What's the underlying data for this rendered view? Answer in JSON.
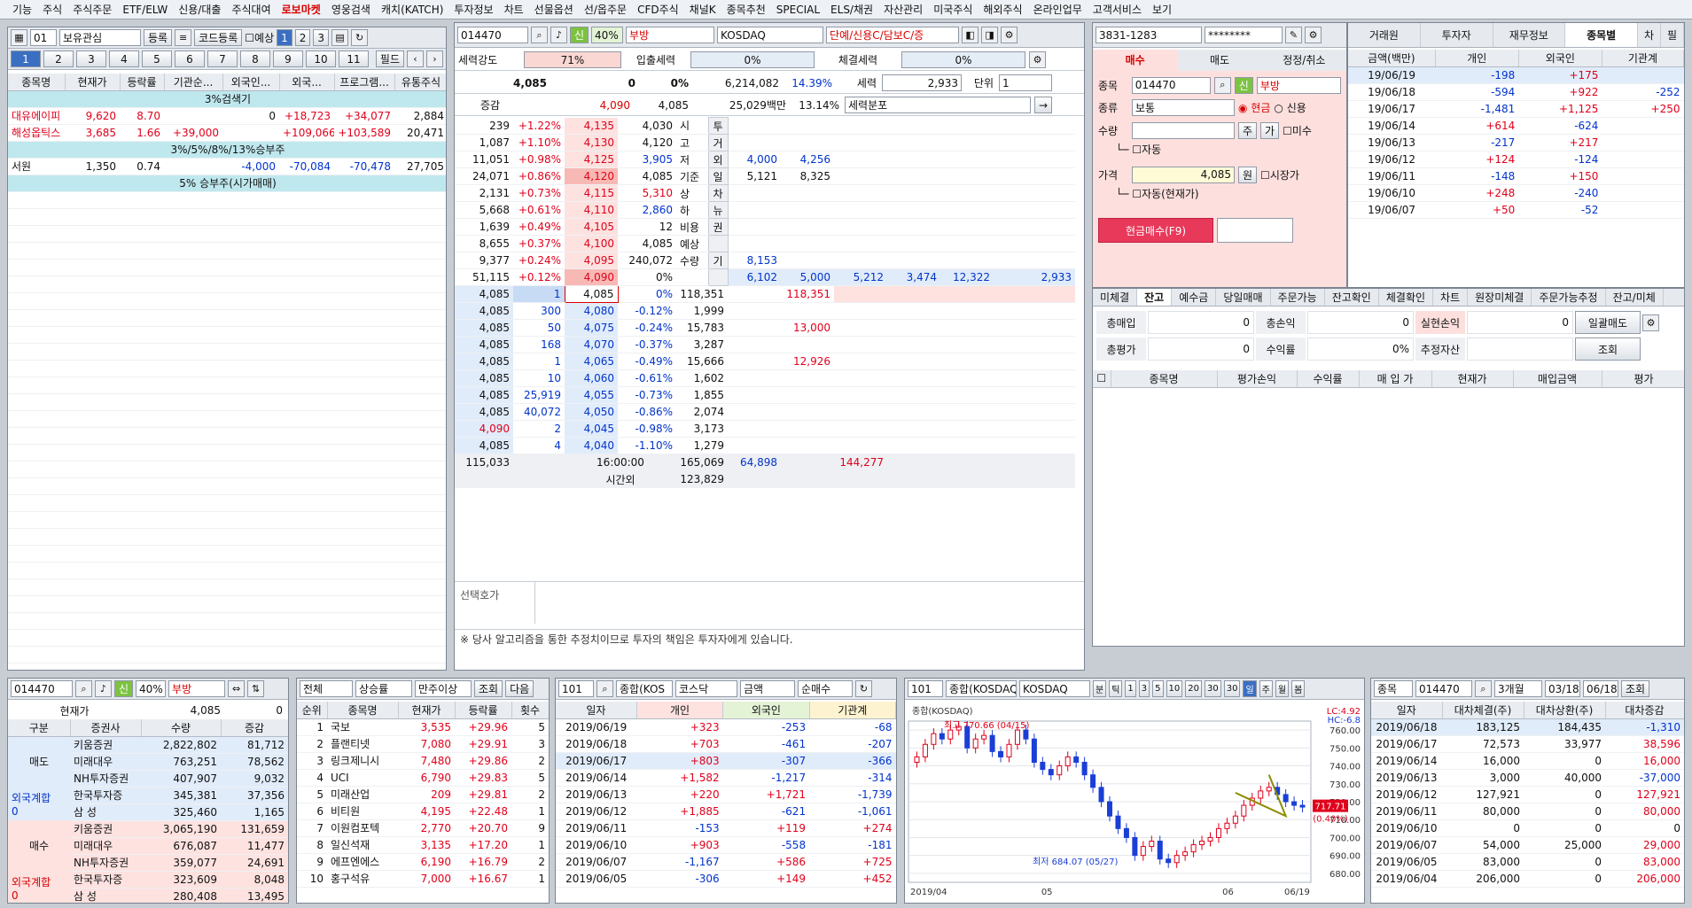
{
  "menu": [
    "기능",
    "주식",
    "주식주문",
    "ETF/ELW",
    "신용/대출",
    "주식대여",
    "로보마켓",
    "영웅검색",
    "캐치(KATCH)",
    "투자정보",
    "차트",
    "선물옵션",
    "선/옵주문",
    "CFD주식",
    "채널K",
    "종목추천",
    "SPECIAL",
    "ELS/채권",
    "자산관리",
    "미국주식",
    "해외주식",
    "온라인업무",
    "고객서비스",
    "보기"
  ],
  "menu_highlight": "로보마켓",
  "watch": {
    "group_no": "01",
    "group_name": "보유관심",
    "register": "등록",
    "code_register": "코드등록",
    "forecast": "예상",
    "pages": [
      "1",
      "2",
      "3"
    ],
    "tabs": [
      "1",
      "2",
      "3",
      "4",
      "5",
      "6",
      "7",
      "8",
      "9",
      "10",
      "11"
    ],
    "field": "필드",
    "headers": [
      "종목명",
      "현재가",
      "등락률",
      "기관순...",
      "외국인...",
      "외국...",
      "프로그램...",
      "유통주식"
    ],
    "rows": [
      {
        "sec": "3%검색기"
      },
      {
        "c": [
          "대유에이피",
          "9,620",
          "8.70",
          "",
          "0",
          "+18,723",
          "+34,077",
          "2,884"
        ],
        "cl": [
          "r",
          "r",
          "r",
          "k",
          "k",
          "r",
          "r",
          "k"
        ]
      },
      {
        "c": [
          "해성옵틱스",
          "3,685",
          "1.66",
          "+39,000",
          "",
          "+109,066",
          "+103,589",
          "20,471"
        ],
        "cl": [
          "r",
          "r",
          "r",
          "r",
          "k",
          "r",
          "r",
          "k"
        ]
      },
      {
        "sec": "3%/5%/8%/13%승부주"
      },
      {
        "c": [
          "서원",
          "1,350",
          "0.74",
          "",
          "-4,000",
          "-70,084",
          "-70,478",
          "27,705"
        ],
        "cl": [
          "k",
          "k",
          "k",
          "k",
          "b",
          "b",
          "b",
          "k"
        ]
      },
      {
        "sec": "5% 승부주(시가매매)"
      }
    ]
  },
  "quote": {
    "code": "014470",
    "credit": "신",
    "margin": "40%",
    "name": "부방",
    "market": "KOSDAQ",
    "flags": "단예/신용C/담보C/증",
    "strength_label": "세력강도",
    "strength": "71%",
    "flow_label": "입출세력",
    "flow": "0%",
    "exec_label": "체결세력",
    "exec": "0%",
    "price": "4,085",
    "change": "0",
    "rate": "0%",
    "volume": "6,214,082",
    "vol_rate": "14.39%",
    "force_label": "세력",
    "force_val": "2,933",
    "unit_label": "단위",
    "unit_val": "1",
    "r2": [
      "증감",
      "4,090",
      "4,085",
      "25,029백만",
      "13.14%",
      "세력분포"
    ],
    "asks": [
      [
        "239",
        "+1.22%",
        "4,135",
        "4,030",
        "시",
        "투"
      ],
      [
        "1,087",
        "+1.10%",
        "4,130",
        "4,120",
        "고",
        "거"
      ],
      [
        "11,051",
        "+0.98%",
        "4,125",
        "3,905",
        "저",
        "외"
      ],
      [
        "24,071",
        "+0.86%",
        "4,120",
        "4,085",
        "기준",
        "일"
      ],
      [
        "2,131",
        "+0.73%",
        "4,115",
        "5,310",
        "상",
        "차"
      ],
      [
        "5,668",
        "+0.61%",
        "4,110",
        "2,860",
        "하",
        "뉴"
      ],
      [
        "1,639",
        "+0.49%",
        "4,105",
        "12",
        "비용",
        "권"
      ],
      [
        "8,655",
        "+0.37%",
        "4,100",
        "4,085",
        "예상",
        ""
      ],
      [
        "9,377",
        "+0.24%",
        "4,095",
        "240,072",
        "수량",
        "기"
      ],
      [
        "51,115",
        "+0.12%",
        "4,090",
        "0%",
        "",
        ""
      ]
    ],
    "mid": [
      [
        "4,000",
        "4,256"
      ],
      [
        "5,121",
        "8,325"
      ],
      [
        "8,153",
        ""
      ],
      [
        "6,102",
        "5,000",
        "5,212",
        "3,474",
        "12,322",
        "2,933"
      ]
    ],
    "bids": [
      [
        "4,085",
        "1",
        "4,085",
        "0%",
        "118,351",
        "118,351"
      ],
      [
        "4,085",
        "300",
        "4,080",
        "-0.12%",
        "1,999",
        ""
      ],
      [
        "4,085",
        "50",
        "4,075",
        "-0.24%",
        "15,783",
        "13,000"
      ],
      [
        "4,085",
        "168",
        "4,070",
        "-0.37%",
        "3,287",
        ""
      ],
      [
        "4,085",
        "1",
        "4,065",
        "-0.49%",
        "15,666",
        "12,926"
      ],
      [
        "4,085",
        "10",
        "4,060",
        "-0.61%",
        "1,602",
        ""
      ],
      [
        "4,085",
        "25,919",
        "4,055",
        "-0.73%",
        "1,855",
        ""
      ],
      [
        "4,085",
        "40,072",
        "4,050",
        "-0.86%",
        "2,074",
        ""
      ],
      [
        "4,090",
        "2",
        "4,045",
        "-0.98%",
        "3,173",
        ""
      ],
      [
        "4,085",
        "4",
        "4,040",
        "-1.10%",
        "1,279",
        ""
      ]
    ],
    "totals": [
      "115,033",
      "16:00:00",
      "165,069",
      "64,898",
      "144,277"
    ],
    "after_label": "시간외",
    "after_val": "123,829",
    "select_hoga": "선택호가",
    "notice": "※ 당사 알고리즘을 통한 추정치이므로 투자의 책임은 투자자에게 있습니다."
  },
  "order": {
    "account": "3831-1283",
    "password": "********",
    "tabs": [
      "매수",
      "매도",
      "정정/취소"
    ],
    "code_label": "종목",
    "code": "014470",
    "name": "부방",
    "type_label": "종류",
    "type": "보통",
    "cash": "현금",
    "credit": "신용",
    "qty_label": "수량",
    "stock": "주",
    "go": "가",
    "unpaid": "미수",
    "auto": "자동",
    "price_label": "가격",
    "price": "4,085",
    "won": "원",
    "market_price": "시장가",
    "auto2": "자동(현재가)",
    "buy_btn": "현금매수(F9)"
  },
  "investor": {
    "tabs": [
      "거래원",
      "투자자",
      "재무정보",
      "종목별"
    ],
    "side": [
      "차",
      "필"
    ],
    "unit": "금액(백만)",
    "headers": [
      "개인",
      "외국인",
      "기관계"
    ],
    "rows": [
      [
        "19/06/19",
        "-198",
        "+175",
        ""
      ],
      [
        "19/06/18",
        "-594",
        "+922",
        "-252"
      ],
      [
        "19/06/17",
        "-1,481",
        "+1,125",
        "+250"
      ],
      [
        "19/06/14",
        "+614",
        "-624",
        ""
      ],
      [
        "19/06/13",
        "-217",
        "+217",
        ""
      ],
      [
        "19/06/12",
        "+124",
        "-124",
        ""
      ],
      [
        "19/06/11",
        "-148",
        "+150",
        ""
      ],
      [
        "19/06/10",
        "+248",
        "-240",
        ""
      ],
      [
        "19/06/07",
        "+50",
        "-52",
        ""
      ]
    ]
  },
  "balance": {
    "tabs": [
      "미체결",
      "잔고",
      "예수금",
      "당일매매",
      "주문가능",
      "잔고확인",
      "체결확인",
      "차트",
      "원장미체결",
      "주문가능추정",
      "잔고/미체"
    ],
    "labels": [
      "총매입",
      "총손익",
      "실현손익",
      "총평가",
      "수익률",
      "추정자산",
      "일괄매도",
      "조회"
    ],
    "values": [
      "0",
      "0",
      "0",
      "0",
      "0%"
    ],
    "headers": [
      "종목명",
      "평가손익",
      "수익률",
      "매 입 가",
      "현재가",
      "매입금액",
      "평가"
    ]
  },
  "broker": {
    "code": "014470",
    "credit": "신",
    "margin": "40%",
    "name": "부방",
    "cur_label": "현재가",
    "cur": "4,085",
    "chg": "0",
    "headers": [
      "구분",
      "증권사",
      "수량",
      "증감"
    ],
    "sell_label": "매도",
    "buy_label": "매수",
    "foreign_label": "외국계합",
    "foreign_val": "0",
    "sells": [
      [
        "키움증권",
        "2,822,802",
        "81,712"
      ],
      [
        "미래대우",
        "763,251",
        "78,562"
      ],
      [
        "NH투자증권",
        "407,907",
        "9,032"
      ],
      [
        "한국투자증",
        "345,381",
        "37,356"
      ],
      [
        "삼 성",
        "325,460",
        "1,165"
      ]
    ],
    "buys": [
      [
        "키움증권",
        "3,065,190",
        "131,659"
      ],
      [
        "미래대우",
        "676,087",
        "11,477"
      ],
      [
        "NH투자증권",
        "359,077",
        "24,691"
      ],
      [
        "한국투자증",
        "323,609",
        "8,048"
      ],
      [
        "삼 성",
        "280,408",
        "13,495"
      ]
    ]
  },
  "rank": {
    "f1": "전체",
    "f2": "상승률",
    "f3": "만주이상",
    "q": "조회",
    "next": "다음",
    "headers": [
      "순위",
      "종목명",
      "현재가",
      "등락률",
      "횟수"
    ],
    "rows": [
      [
        "1",
        "국보",
        "3,535",
        "+29.96",
        "5"
      ],
      [
        "2",
        "플랜티넷",
        "7,080",
        "+29.91",
        "3"
      ],
      [
        "3",
        "링크제니시",
        "7,480",
        "+29.86",
        "2"
      ],
      [
        "4",
        "UCI",
        "6,790",
        "+29.83",
        "5"
      ],
      [
        "5",
        "미래산업",
        "209",
        "+29.81",
        "2"
      ],
      [
        "6",
        "비티원",
        "4,195",
        "+22.48",
        "1"
      ],
      [
        "7",
        "이원컴포텍",
        "2,770",
        "+20.70",
        "9"
      ],
      [
        "8",
        "일신석재",
        "3,135",
        "+17.20",
        "1"
      ],
      [
        "9",
        "에프엔에스",
        "6,190",
        "+16.79",
        "2"
      ],
      [
        "10",
        "홍구석유",
        "7,000",
        "+16.67",
        "1"
      ]
    ]
  },
  "market_inv": {
    "code": "101",
    "f1": "종합(KOS",
    "f2": "코스닥",
    "f3": "금액",
    "f4": "순매수",
    "headers": [
      "일자",
      "개인",
      "외국인",
      "기관계"
    ],
    "rows": [
      [
        "2019/06/19",
        "+323",
        "-253",
        "-68"
      ],
      [
        "2019/06/18",
        "+703",
        "-461",
        "-207"
      ],
      [
        "2019/06/17",
        "+803",
        "-307",
        "-366"
      ],
      [
        "2019/06/14",
        "+1,582",
        "-1,217",
        "-314"
      ],
      [
        "2019/06/13",
        "+220",
        "+1,721",
        "-1,739"
      ],
      [
        "2019/06/12",
        "+1,885",
        "-621",
        "-1,061"
      ],
      [
        "2019/06/11",
        "-153",
        "+119",
        "+274"
      ],
      [
        "2019/06/10",
        "+903",
        "-558",
        "-181"
      ],
      [
        "2019/06/07",
        "-1,167",
        "+586",
        "+725"
      ],
      [
        "2019/06/05",
        "-306",
        "+149",
        "+452"
      ]
    ]
  },
  "chart": {
    "code": "101",
    "name": "종합(KOSDAQ)",
    "market": "KOSDAQ",
    "toolbar": [
      "분",
      "틱",
      "1",
      "3",
      "5",
      "10",
      "20",
      "30",
      "30",
      "일",
      "주",
      "월",
      "봄"
    ],
    "title": "종합(KOSDAQ)",
    "lc": "LC:4.92",
    "hc": "HC:-6.8",
    "high_label": "최고 770.66 (04/15)",
    "low_label": "최저 684.07 (05/27)",
    "last": "717.71",
    "last_pct": "(0.40%)",
    "y_ticks": [
      "760.00",
      "750.00",
      "740.00",
      "730.00",
      "720.00",
      "710.00",
      "700.00",
      "690.00",
      "680.00"
    ],
    "x_labels": [
      "2019/04",
      "05",
      "06",
      "06/19"
    ]
  },
  "lending": {
    "f1": "종목",
    "code": "014470",
    "period": "3개월",
    "from": "03/18",
    "to": "06/18",
    "q": "조회",
    "headers": [
      "일자",
      "대차체결(주)",
      "대차상환(주)",
      "대차증감"
    ],
    "rows": [
      [
        "2019/06/18",
        "183,125",
        "184,435",
        "-1,310"
      ],
      [
        "2019/06/17",
        "72,573",
        "33,977",
        "38,596"
      ],
      [
        "2019/06/14",
        "16,000",
        "0",
        "16,000"
      ],
      [
        "2019/06/13",
        "3,000",
        "40,000",
        "-37,000"
      ],
      [
        "2019/06/12",
        "127,921",
        "0",
        "127,921"
      ],
      [
        "2019/06/11",
        "80,000",
        "0",
        "80,000"
      ],
      [
        "2019/06/10",
        "0",
        "0",
        "0"
      ],
      [
        "2019/06/07",
        "54,000",
        "25,000",
        "29,000"
      ],
      [
        "2019/06/05",
        "83,000",
        "0",
        "83,000"
      ],
      [
        "2019/06/04",
        "206,000",
        "0",
        "206,000"
      ]
    ]
  }
}
